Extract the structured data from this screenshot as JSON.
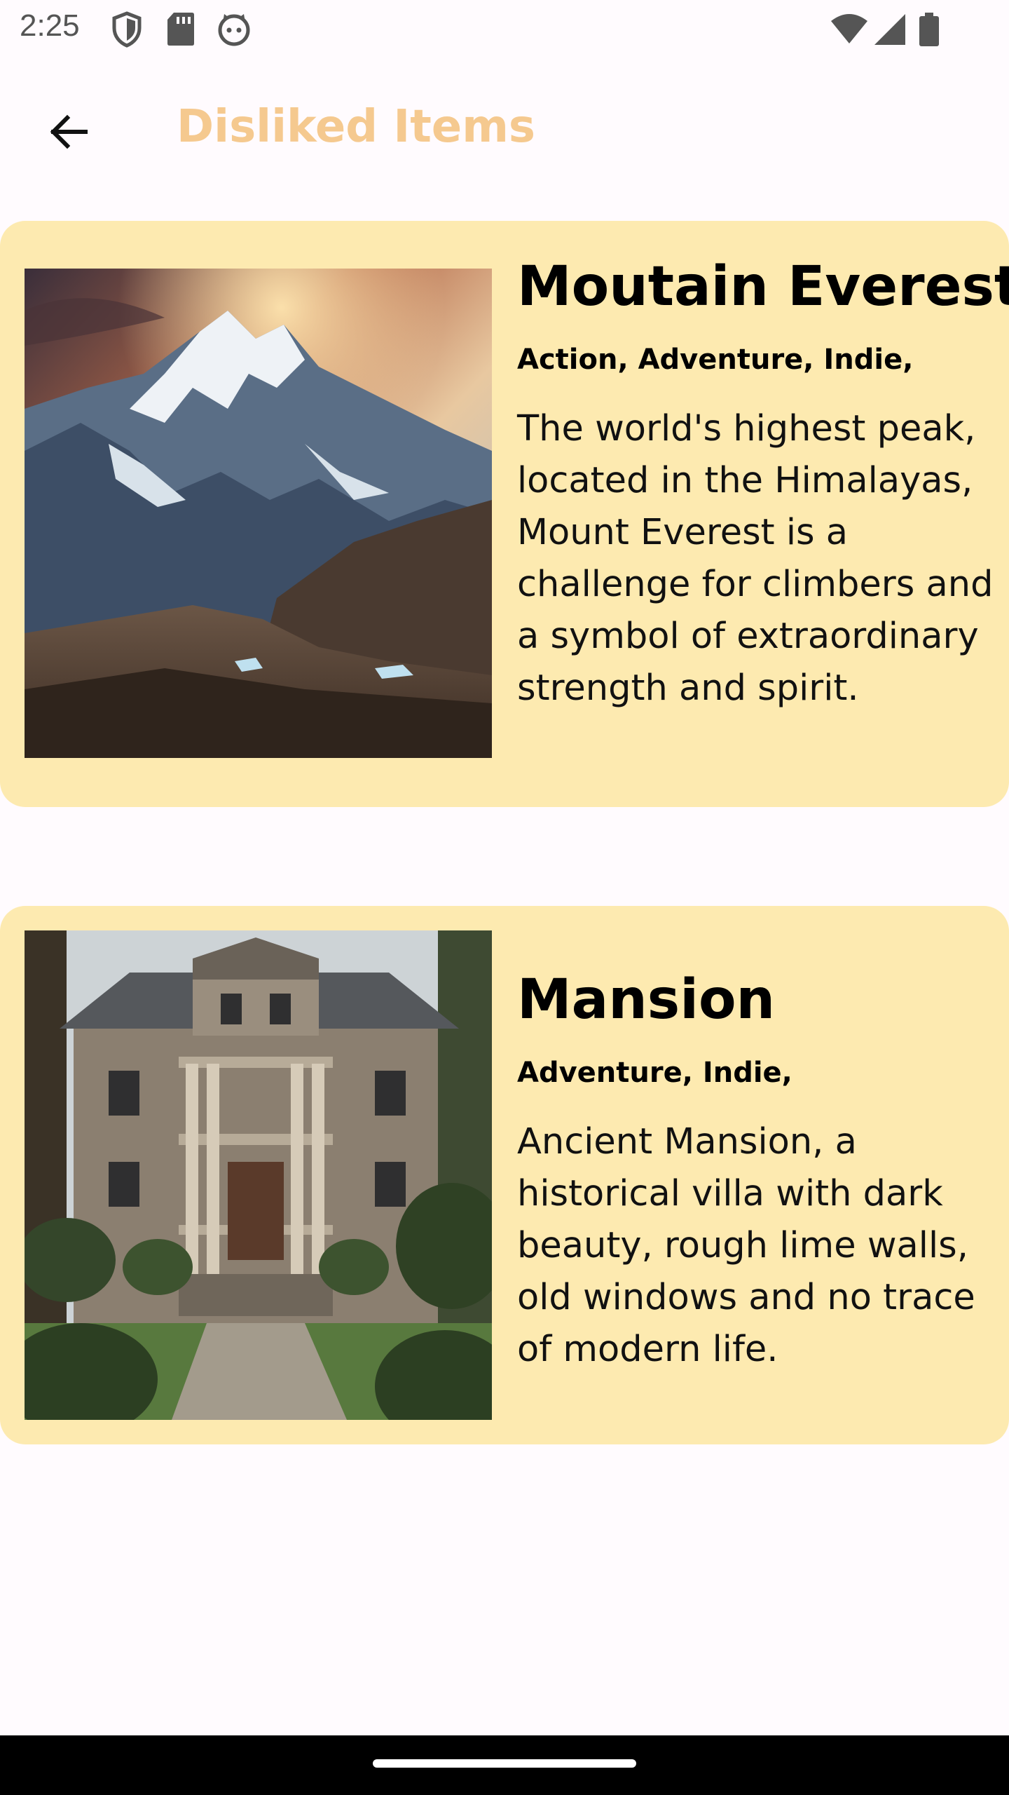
{
  "status_bar": {
    "time": "2:25",
    "icons": [
      "shield-icon",
      "sd-card-icon",
      "cat-face-icon",
      "wifi-icon",
      "signal-icon",
      "battery-icon"
    ]
  },
  "app_bar": {
    "back_icon": "arrow-back-icon",
    "title": "Disliked Items",
    "title_color": "#f5c98f"
  },
  "colors": {
    "card_background": "#fdeab0",
    "page_background": "#fffbfe"
  },
  "items": [
    {
      "title": "Moutain Everest",
      "tags": "Action, Adventure, Indie,",
      "description": "The world's highest peak, located in the Himalayas, Mount Everest is a challenge for climbers and a symbol of extraordinary strength and spirit."
    },
    {
      "title": "Mansion",
      "tags": "Adventure, Indie,",
      "description": "Ancient Mansion, a historical villa with dark beauty, rough lime walls, old windows and no trace of modern life."
    }
  ]
}
